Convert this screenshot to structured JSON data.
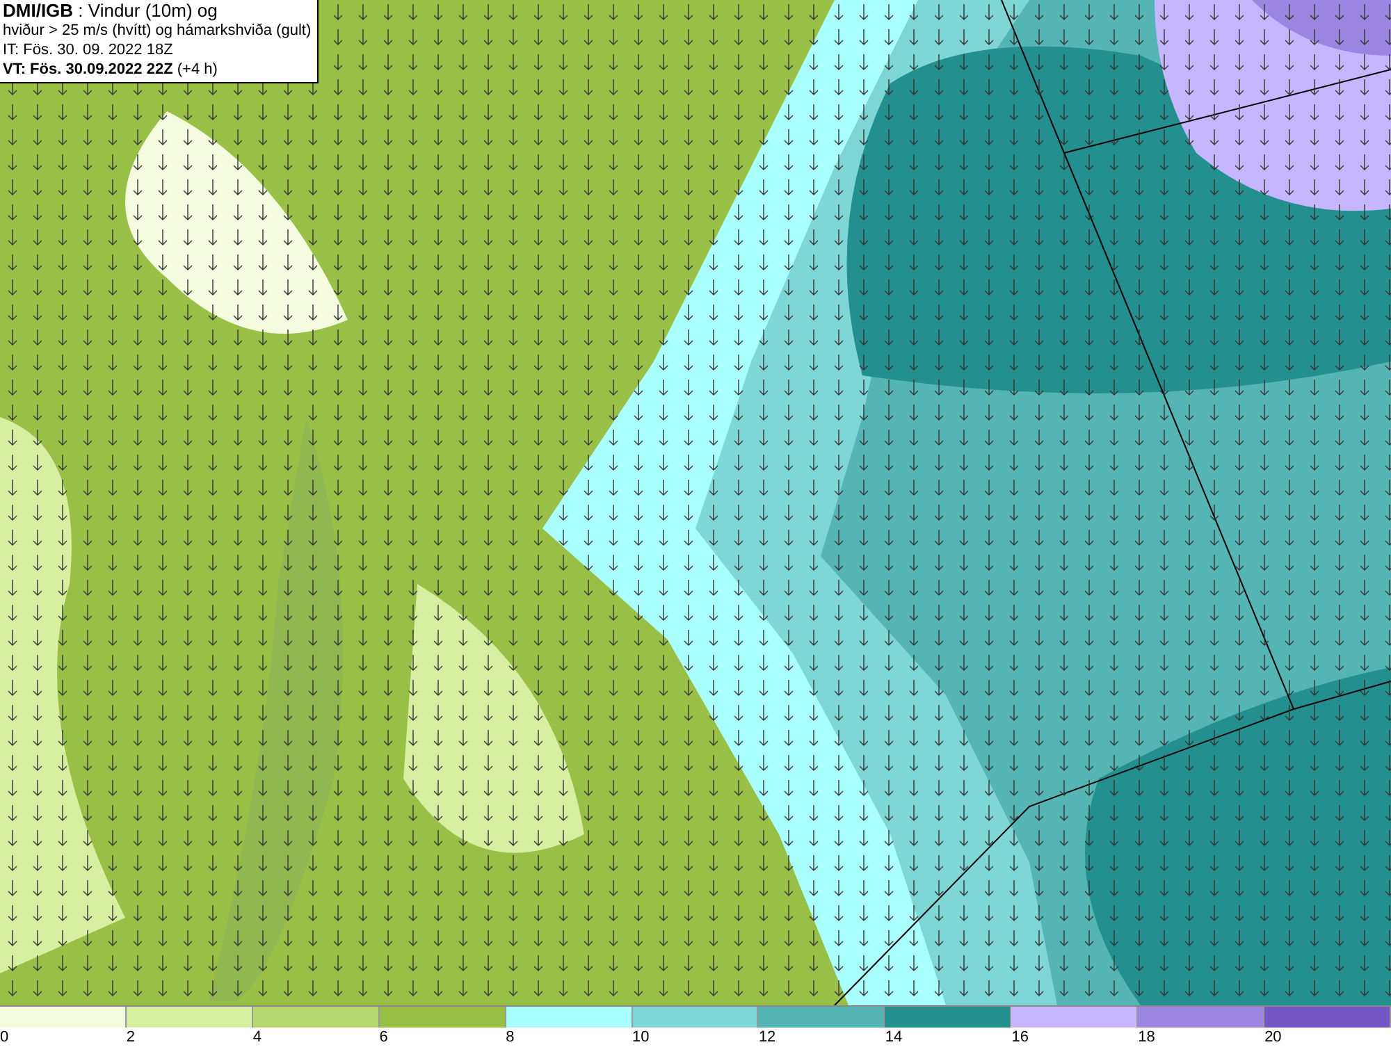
{
  "header": {
    "lines": [
      "**DMI/IGB** : Vindur (10m) og",
      "hviður > 25 m/s (hvítt) og hámarkshviða (gult)",
      "IT: Fös. 30. 09. 2022 18Z",
      "**VT: Fös. 30.09.2022 22Z** (+4 h)"
    ]
  },
  "legend": [
    {
      "label": "0",
      "color": "#f5fbdf"
    },
    {
      "label": "2",
      "color": "#d8eea0"
    },
    {
      "label": "4",
      "color": "#b7d870"
    },
    {
      "label": "6",
      "color": "#98c046"
    },
    {
      "label": "8",
      "color": "#aaffff"
    },
    {
      "label": "10",
      "color": "#7fd6d6"
    },
    {
      "label": "12",
      "color": "#55b4b4"
    },
    {
      "label": "14",
      "color": "#238f8f"
    },
    {
      "label": "16",
      "color": "#c6b6ff"
    },
    {
      "label": "18",
      "color": "#9a86e0"
    },
    {
      "label": "20",
      "color": "#7256c4"
    }
  ]
}
